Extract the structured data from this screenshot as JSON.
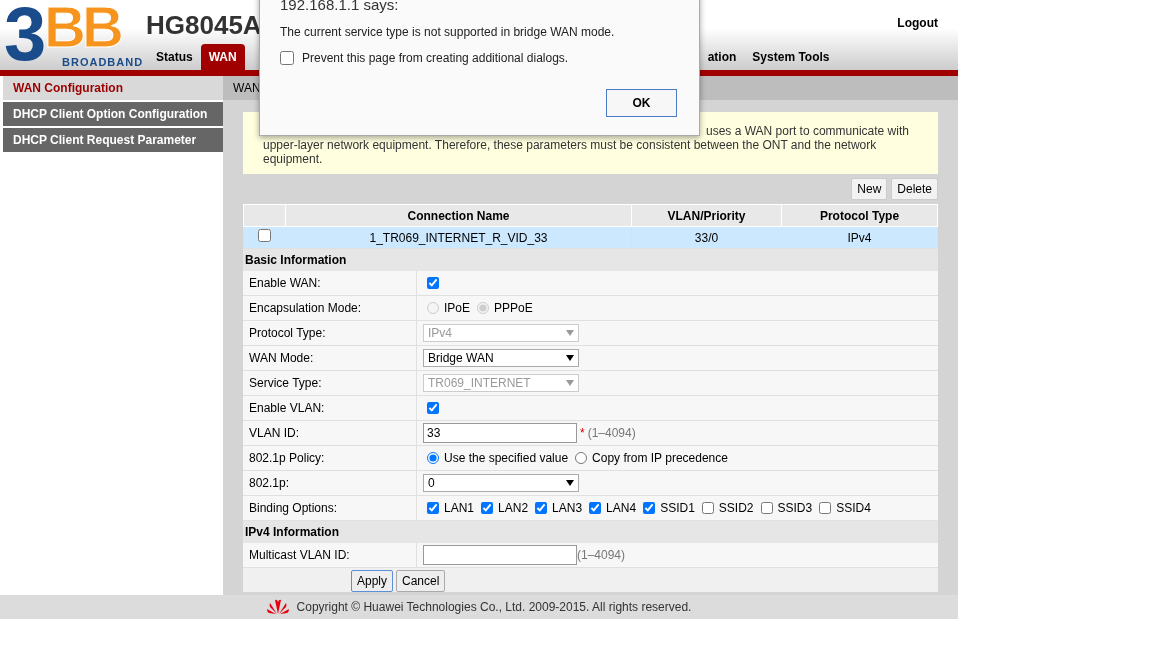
{
  "header": {
    "logo_digit": "3",
    "logo_letters": "BB",
    "logo_tagline": "BROADBAND",
    "model": "HG8045A",
    "logout": "Logout"
  },
  "nav_tabs": [
    {
      "label": "Status",
      "selected": false
    },
    {
      "label": "WAN",
      "selected": true
    },
    {
      "label": "ation",
      "selected": false
    },
    {
      "label": "System Tools",
      "selected": false
    }
  ],
  "sidebar": {
    "items": [
      {
        "label": "WAN Configuration",
        "selected": true
      },
      {
        "label": "DHCP Client Option Configuration",
        "selected": false
      },
      {
        "label": "DHCP Client Request Parameter",
        "selected": false
      }
    ]
  },
  "breadcrumb": "WAN",
  "notice": "uses a WAN port to communicate with upper-layer network equipment. Therefore, these parameters must be consistent between the ONT and the network equipment.",
  "table_buttons": [
    "New",
    "Delete"
  ],
  "table": {
    "columns": [
      "Connection Name",
      "VLAN/Priority",
      "Protocol Type"
    ],
    "rows": [
      {
        "checked": false,
        "highlighted": true,
        "cells": [
          "1_TR069_INTERNET_R_VID_33",
          "33/0",
          "IPv4"
        ]
      }
    ]
  },
  "sections": [
    {
      "title": "Basic Information",
      "rows": [
        {
          "label": "Enable WAN:",
          "kind": "checkbox",
          "checked": true
        },
        {
          "label": "Encapsulation Mode:",
          "kind": "radio",
          "disabled": true,
          "options": [
            {
              "label": "IPoE",
              "selected": false
            },
            {
              "label": "PPPoE",
              "selected": true
            }
          ]
        },
        {
          "label": "Protocol Type:",
          "kind": "select",
          "value": "IPv4",
          "disabled": true
        },
        {
          "label": "WAN Mode:",
          "kind": "select",
          "value": "Bridge WAN",
          "disabled": false
        },
        {
          "label": "Service Type:",
          "kind": "select",
          "value": "TR069_INTERNET",
          "disabled": true
        },
        {
          "label": "Enable VLAN:",
          "kind": "checkbox",
          "checked": true
        },
        {
          "label": "VLAN ID:",
          "kind": "text",
          "value": "33",
          "marker": "*",
          "hint": "(1–4094)"
        },
        {
          "label": "802.1p Policy:",
          "kind": "radio",
          "disabled": false,
          "options": [
            {
              "label": "Use the specified value",
              "selected": true
            },
            {
              "label": "Copy from IP precedence",
              "selected": false
            }
          ]
        },
        {
          "label": "802.1p:",
          "kind": "select",
          "value": "0",
          "disabled": false
        },
        {
          "label": "Binding Options:",
          "kind": "checklist",
          "options": [
            {
              "label": "LAN1",
              "checked": true
            },
            {
              "label": "LAN2",
              "checked": true
            },
            {
              "label": "LAN3",
              "checked": true
            },
            {
              "label": "LAN4",
              "checked": true
            },
            {
              "label": "SSID1",
              "checked": true
            },
            {
              "label": "SSID2",
              "checked": false
            },
            {
              "label": "SSID3",
              "checked": false
            },
            {
              "label": "SSID4",
              "checked": false
            }
          ]
        }
      ]
    },
    {
      "title": "IPv4 Information",
      "rows": [
        {
          "label": "Multicast VLAN ID:",
          "kind": "text",
          "value": "",
          "hint": "(1–4094)"
        }
      ]
    }
  ],
  "form_buttons": [
    "Apply",
    "Cancel"
  ],
  "footer": "Copyright © Huawei Technologies Co., Ltd. 2009-2015. All rights reserved.",
  "dialog": {
    "title": "192.168.1.1 says:",
    "message": "The current service type is not supported in bridge WAN mode.",
    "checkbox_label": "Prevent this page from creating additional dialogs.",
    "checkbox_checked": false,
    "button": "OK"
  }
}
